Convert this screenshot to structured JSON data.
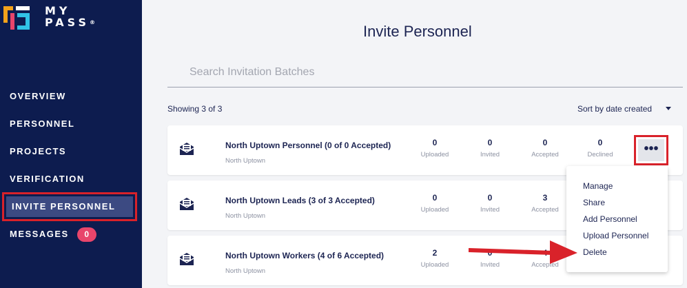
{
  "brand": {
    "line1": "MY",
    "line2": "PASS",
    "mark": "®"
  },
  "sidebar": {
    "items": [
      {
        "label": "OVERVIEW"
      },
      {
        "label": "PERSONNEL"
      },
      {
        "label": "PROJECTS"
      },
      {
        "label": "VERIFICATION"
      },
      {
        "label": "INVITE PERSONNEL"
      },
      {
        "label": "MESSAGES",
        "badge": "0"
      }
    ]
  },
  "main": {
    "title": "Invite Personnel",
    "search": {
      "placeholder": "Search Invitation Batches"
    },
    "showing": "Showing 3 of 3",
    "sort_label": "Sort by date created",
    "stat_labels": [
      "Uploaded",
      "Invited",
      "Accepted",
      "Declined"
    ],
    "batches": [
      {
        "title": "North Uptown Personnel (0 of 0 Accepted)",
        "subtitle": "North Uptown",
        "stats": [
          "0",
          "0",
          "0",
          "0"
        ]
      },
      {
        "title": "North Uptown Leads (3 of 3 Accepted)",
        "subtitle": "North Uptown",
        "stats": [
          "0",
          "0",
          "3"
        ]
      },
      {
        "title": "North Uptown Workers (4 of 6 Accepted)",
        "subtitle": "North Uptown",
        "stats": [
          "2",
          "0",
          "4"
        ]
      }
    ],
    "more_button": "•••",
    "menu": [
      "Manage",
      "Share",
      "Add Personnel",
      "Upload Personnel",
      "Delete"
    ]
  },
  "colors": {
    "sidebar": "#0d1c4f",
    "highlight": "#d9222a",
    "badge": "#e8456b",
    "text": "#1c2452"
  },
  "icons": {
    "logo": "mypass-logo-icon",
    "batch": "envelope-icon",
    "more": "ellipsis-icon",
    "sort": "caret-down-icon"
  }
}
